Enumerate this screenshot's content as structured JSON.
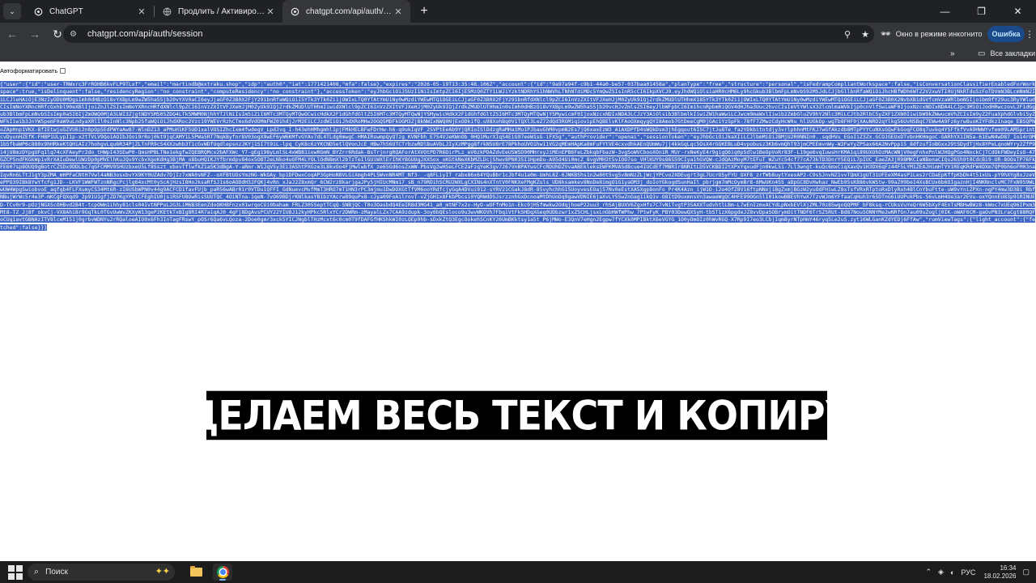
{
  "tabs": [
    {
      "title": "ChatGPT",
      "icon": "chatgpt-icon",
      "active": false
    },
    {
      "title": "Продлить / Активировать - GPT",
      "icon": "globe-icon",
      "active": false
    },
    {
      "title": "chatgpt.com/api/auth/session",
      "icon": "chatgpt-icon",
      "active": true
    }
  ],
  "toolbar": {
    "url": "chatgpt.com/api/auth/session",
    "incognito_label": "Окно в режиме инкогнито",
    "error_button": "Ошибка"
  },
  "bookmarks": {
    "all_label": "Все закладки"
  },
  "page": {
    "autoformat_label": "Автоформатировать",
    "autoformat_checked": false,
    "json_text": "{\"user\":{\"id\":\"user-TRWxrc3FrROHB6kvFLP9TLxf\",\"email\":\"martindb@extraku.shop\",\"idp\":\"auth0\",\"iat\":1771421408,\"mfa\":false},\"expires\":\"2026-05-19T13:35:48.106Z\",\"account\":{\"id\":\"9a97a94f-c9b1-44a0-be57-037baa01458a\",\"planType\":\"free\",\"structure\":\"personal\",\"isFedrampCompliantWorkspace\":false,\"isConversationClassifierEnabledForWorkspace\":true,\"isDelinquent\":false,\"residencyRegion\":\"no_constraint\",\"computeResidency\":\"no_constraint\"},\"accessToken\":\"eyJhbGciOiJSUzI1NiIsImtpZCI6IjE5MzQ0ZTY1LWJiYzktNDRhYS1hNWVhLTNhNTdiMDc5YmQwZSIsInR5cCI6IkpXVCJ9.eyJhdWQiOlsiaHR0cHM6Ly9hcGkub3BlbmFpLmNvbS92MSJdLCJjbGllbnRfaWQiOiJhcHBfWDh6WTZ2V2xwVTI0UjNkRTduSzFoTDVmN3BLcmNmN2IiLCJleHAiOjE3NzIyODU0MDgsImh0dHBzOi8vYXBpLm9wZW5haS5jb20vYXV0aCI6eyJjaGF0Z3B0X2FjY291bnRfaWQiOiI5YTk3YTk0Zi1jOWIxLTQ0YTAtYmU1Ny0wMzdiYWEwMTQ1OGEiLCJjaGF0Z3B0X2FjY291bnRfdXNlcl9pZCI6InVzZXItVFJXeHJjM0ZyUk9IQjZrdkZMUDlUTHhmX185YTk3YTk0Zi1jOWIxLTQ0YTAtYmU1Ny0wMzdiYWEwMTQ1OGEiLCJjaGF0Z3B0X2NvbXB1dGVfcmVzaWRlbmN5Ijoibm9fY29uc3RyYWludCIsImNoYXRncHRfcGxhbl90eXBlIjoiZnJlZSIsImNoYXRncHRfdXNlcl9pZCI6InVzZXItVFJXeHJjM0ZyUk9IQjZrdkZMUDlUTHhmIiwidXNlcl9pZCI6InVzZXItVFJXeHJjM0ZyUk9IQjZrdkZMUDlUTHhmIn0sImh0dHBzOi8vYXBpLm9wZW5haS5jb20vcHJvZmlsZSI6eyJlbWFpbCI6Im1hcnRpbmRiQGV4dHJha3Uuc2hvcCIsImVtYWlsX3ZlcmlmaWVkIjp0cnVlfSwiaWF0IjoxNzcxNDIxNDA4LCJpc3MiOiJodHRwczovL2F1dGgub3BlbmFpLmNvbSIsImp0aSI6IjZmOWQ0MjA3LWI3ZjgtNDY5MS05ZDQ4LTk5MWM0NjhhYTJlNiIsIm5iZiI6MTc3MTQyMTQwOCwicHdkX2F1dGhfdGltZSI6MTc3MTQyMTQwNjY5MywicHdkX2F1dGhfdGltZSI6MTc3MTQyMTQwNjY5MywicmF0IjoxNzcxNDIxNDA3LCJzY3AiOlsib3BlbmlkIiwiZW1haWwiLCJwcm9maWxlIiwib2ZmbGluZV9hY2Nlc3MiLCJtb2RlbC5yZXF1ZXN0IiwibW9kZWwucmVhZCIsIm9yZ2FuaXphdGlvbi5yZWFkIiwib3JnYW5pemF0aW9uLndyaXRlIl0sInNlc3Npb25faWQiOiJhdXRoc2Vzc19YWEVrRzhCTmx6dVdOMmFWZ01hdjJrM2EiLCJzdWIiOiJhdXRoMHw2OGQ5MDFkOGM3ZjBkNWIxNWQ0NjExODkifQ.u98XohBq0V1TQXl3LeZ72dQd3RGMiqiovipEhQBElvKlFAoOXmqygQYI8Amob7GtDeeCgM0jGAciYzSpFk-78fF7ZMwzCdyHcW0u_hl1UGkOp-wgTb8FHF0jXAuNRD2qYlkg56UvNSBqC7EWw4A9Fz6yrw8uoKIYFdkzInaqe_EBSQPNoZApHnp1VKX-8fIEtwjuGZVU6i2n8pOp5EdPWYaAw87-WlnDZ13_aPMuH1KF5UD1xalVOSIZhcIxm4fwdegV_LpdJvq_I-h43ehHMhgmhl1pjFMkHELBFwFDrHw-h6-q9ukIqVF_2SVPtEeAb9YjQRIoISlDdzgRaMHa1Mu1PJbauGhM0vpmN2Es7jQ6xaxEzW3_A1AXDPfD4sWQkDsm3jhEgqout6ISC7jtJu8Te_fa2YDkbitntdjy3vrlphhnMtFKJ7wGfAkzdb8MTpPYYCuNXsGQwFkGoqFCO8q7uvkq4YSFfkfVvA9HWWYvfem09LAMSprintcvDyunHZEfK-FHBP1ULypI1p-x2tTVLV9Qo1AOIbJOoi9rRoj0kt9jqCAMY1L5PWa5RT7NqkByfnr8V03ogX9wEF6yW6KMfvGYAv7dL4TLdg0mwgC-HMAIRswmpQyQTzg_KVNFbh_E7S4VJeKWnOb_0HQ1MurXIqS4EiG97eeW1sG-iFX5g\",\"authProvider\":\"openai\",\"sessionToken\":\"eyJhbGciOiJkaXIiLCJlbmMiOiJBMjU2R0NNIn0..sqdHVu_EGoIiZ3Zx.GCOJGEUxDTvbnHKHmgoC-GARhYX1IN5a-61EwN4wD87_Io14rOM1b5fbaWP6c880x9hHRkeKtQHiAIz7hohgvLqu6R34PjZLTnFR9cS4XXzwhb3T1cGvWDfUqdlepsnzJKYj1SI7t9iL-lpq_CyK8c6zYKCND5etlQVonJcE_HBw7h56UTCTrbzwRDlBuAVbLJIyXzMPgg8frkN5U8rE78PkhoUVO1hw11VG2qMEmHApKa8mFuFYtVE4cxvdhkAEnQUmWu7jj4kkGqLqc5OsX4rGGKEBLuD4vpobusz3Kb6vmQhT93jmCPEEmvnWy-W2FwYyZPSax66A2NvPpp15_8dfzufIoBGxx29tSDydTjHx8YPeLqnoWYry2ZfP9i4jU8mzDYpgUFq1lq74cXFAeyPr2do_tHWpI43SEwP0-QmsHPBLTNe1ekgfwZQEBRQMcx2bAFXWc_Y7-gEg198yLmlSL4xWB81iowRGmN_BYZrr6Rdak-BsTrjnrgRQAForAtXVOtPD7R6DirPLz_eV6zkPDAZdvEeUSWSD90MHrxyJiMEnEPB6FeLZbkqbFbazW-3vgSoWVCbooXOn1R_MUr-rxNeKyE4r9gigQ6iq0pSdlw1BeOpVoRr83F-L19ge6vqIuwsHrKMA1qi89UXOhOzMAcWNjV0egFnhxPnlWJHQgPGo4NockCjTCdOkFWDeyIsO-47GZCPSndFKGkWp1vRrXAIuDewlUWzDp0pMVElhKuJQv9YcbvXgoKdHg3BjMA_o8buHQIKJYfbrmdpv84ox5OBT2eLNko4uOFM4LYOLlOdN8mXl2bTzTeIlGUiWXlErIhKYBGUUgJXXSox_oKGtkNeXKbMZLDcjShwv8PN035I1HpmDu-A95d4Ui0mcZ_8vgVMH3t5vIOO7so_VHlKUY9s86S59CIya1hGVQW-cJdQAzMoyM7tEFuT_WZuYc54cf77cA73kTD3DnrY5EQiL7pIUC_EaeZA3jR98MKCIaNBenaCIQs26Sh9t0CdcBi9-UR-8OOsTP76FkFE607sp8OUQ9gBotrCZSDx9DDLbc7qGFCMMV9SHUzbxeU5Lf8Sszt_xbxvTflwfkZ1aSK3dBgA-Y-aRmr-W1JqV5y3Ei3AShtPXGze3L8kvOo4FjMwlwbfX_ze65Gd6nsZxWW-PbsVg2wHSeLFCE2aFzqYeK3gv7267VnBPAYwsCFcRDUhDZVvaABEkleksEWFKMVASd8cue4IUCdEf7MBRIr8NRItLD5VCKBDI2tXPxYqxudFjn0kwL51-7Ll3wngt-kuQc6mxCiqXavQv1H3DX6qFz44F5LYM1ZEAJHimHTYV1REqKRdFW4DXm7QP0bh6oFM03naIqvRn6LTtJ1gY3pZMA_mHPFaCNtH7Vwl4aNB3osxbvYX9KY0UZAdv7DjIz7xWA0sNFZ--oXFBtUOsYmzNG-WkGAy_bp1DFDwxCoqAP3GpHoN8VLGiXmgh4PL5WvnNR4MT_Nf3-_-q8FLiyIT_rabx86x64YQuBbr1cJbf4u1a0m-UmhL8Z-6JNKBShs1n2w80t5vg5v8mNzZLjWcjYPCvo2XDEugrt3gL7UcrO5yFYU_OXF8_zrfWb8uytYxexAP2-C9sSJnvNZ1vvTQmX1gUT31UFEeXM4asP1Les2rCDaEpKffpKbDk4t51xUs-pY9hXYg8xJzeVePPO39IBk8YwYfcFg1JD--LKVF1WWFWTznNRgcPcjlg64xcMt0yScAjHzsI8HoJksaRfSJ1s6oAODdH3JFQKj4vRn_xJaJ2Z8xmQr_6CW2rz8karjgaJPy5jHIUcMNm17_sB_n79RDihSCRU2WXLgCXINs4nXTntV0FNKXeFMgKZuls_UD8ksamkev8NoDe8imgO1G1yaOM3j_doIoYGkogdSunHaIl_pbrjgm7mMcOymBr8-6MwUKn455_aDpGC8DvHwhaz_NwEb95sK886vkWStw-99aZ09be14XsBCUx6b6OIgaznHjI4NKNnclvMC7FxN959WLwUW4WpgSwiobvoE_aqfqb4FLFXumyCS34Mt6R-zI6USbWPN0v44g9ACFCD1favFUjb_paR56wABr01r0VTDu1QFFI_GdNuevcMvfMmT3HRO7mT1HN3rPC3mjmu1DwDOXGtTfVM6ooYRdfcjyGqA4DVui912-sYRV21CGakJ8dR-85vyhchhG15UoyvesEOaj57Nv0eEstXA5Xgp8onFo_Pr4K4Azn_ijW1D-i2o4OfZ8V16ftpNNojiBgZxmjBGzW2yuOdFHiwLZ8xTsfVRxRTptoRxDlyRxh4BlCnYbuFtte-uW9vYniZPXn-ngPY4mw3D3Bi_RbfNBujWrWc5r4e3P-mKCgFQXqd9_2p91U1gfjZD7KgYPQlCFEghIU0jsiRSFU8OwRisSUUTQC_4OiNTna-1qeN-7vO69BDjrKNlkasYB1bzYAcrw89quPx8-cJya09FoAilrovT-vZjGH1x8FkbPbcsi0YQRWdDSJsrzznhGxDcnoaMtDhUoDq9gawVDNIE6jaXvLY5SwZnGag1ikQ1v-O8ItD9uxmnsVn3awaeWgQC4HFE99OGn5lI01kowBBEVhYwX7TzvWJm6YFfaaCqHuh3r65DTnG6iUUPukPbs-S6vLmH4Ue3ar2EVu-oxYQnnEU83p91RINUED-TCv0r9-pOzjNGXScOHBvd2B4t-tcpOWm1ihhy81cls04IvtNPPoL2G3LiM6B3EenZdoOKH8Fnzx01wrqoCUi0baham FRLZ305SeptTCqQ-SNBjQC-T0o3OasbdQ4EeIR8d3MG41_a0_mtNF7x2v-HyO-wOFfnMo1n-Ekc9jH5fmwkw2OdqjhoeP22uu3_rhSAjBUXV6ZgxHfs7C7vNiTvgtP35AXXTudvhtlLBm-L7wEnIzmxACYdLpNxbEVlXjZML70z85wgoQQPMF_bF8ksq-rCUksVuYeQr6W5bXyF4EnTsMBHwBWz8-kWoc7xUEq96IPxm3Mt8-TZ_Jj8f_okvCj-VX8AhiBr9GqTkL0TGvUwWvZKXyW13geP2KEtkTxBIg8RI4R7aiqAJ0_4gFj8DgAvsPCUY22YIU8J12kyHPkc5RlxYCr2DWRm-zMayalLZx7CAA9zdupk-3oy6bQEsloco9u3wvWKOVh7FbqiVtFkSHDqXGeq0UDbzwr1xZ5CHLjsxLnGbHWfWPhw_7PtwFyK_PBY03DewQXSyH-tbST1zX6pgdeJZ8vvDpaSOBrymOitTNDF6TrSZ5RUt-Bd87Nou5ONNYMe2wNRfGn7au09uZoglj0IK-oWAF6CM-gaOvPN3LraCgt88RQFoCUq1avtGBNAzITV8lceM151j0grbvWDNYu2rRQaloeAIO0x6Fh3InTagFRswY_pOSr6Qa6vLQoza-2Doe0gmr3xck5YICJNgblTHzMcxt6c0cm0T9fDAFGfHKShkWI0zLQEp9hb-sDxkZtQ3EgcOokehSCnKY26UmBKktsy1a5t_P6jMWo-E3QnV7eHgn2Egpw7fYCXk0MPIBktX6eVGYG_1O0yOmOIz0hWvRGQ-X7Rp9I7eo3LCbjIqm8yrNTpHmY46ryq5Le2uS.zyt16WLGanKZdYEDj6FfAw\",\"rumViewTags\":{\"light_account\":{\"fetched\":false}}}"
  },
  "caption": "ВЫДЕЛАЕМ ВЕСЬ ТЕКСТ И КОПИРУЕМ",
  "taskbar": {
    "search_label": "Поиск",
    "language": "РУС",
    "time": "16:34",
    "date": "18.02.2026"
  },
  "colors": {
    "selection": "#3f67c6",
    "chrome_dark": "#202124",
    "chrome_tab": "#35363a"
  }
}
